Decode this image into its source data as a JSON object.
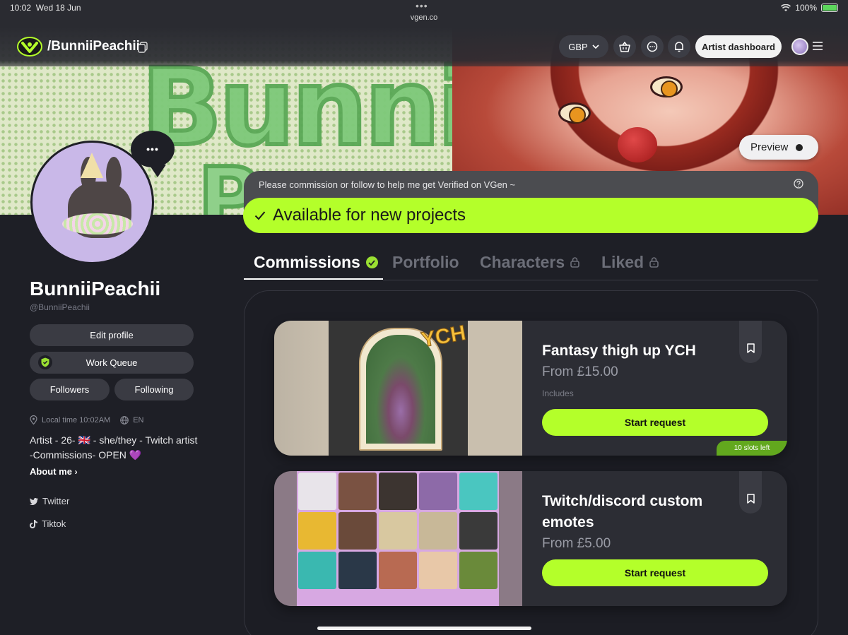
{
  "status_bar": {
    "time": "10:02",
    "date": "Wed 18 Jun",
    "url": "vgen.co",
    "battery": "100%"
  },
  "nav": {
    "username": "/BunniiPeachii",
    "currency": "GBP",
    "artist_dashboard": "Artist dashboard"
  },
  "banner": {
    "preview_label": "Preview"
  },
  "profile": {
    "display_name": "BunniiPeachii",
    "handle": "@BunniiPeachii",
    "edit_profile": "Edit profile",
    "work_queue": "Work Queue",
    "followers": "Followers",
    "following": "Following",
    "local_time": "Local time 10:02AM",
    "language": "EN",
    "bio": "Artist - 26- 🇬🇧 - she/they - Twitch artist -Commissions- OPEN 💜",
    "about_me": "About me",
    "socials": [
      "Twitter",
      "Tiktok"
    ]
  },
  "verify": {
    "prompt": "Please commission or follow to help me get Verified on VGen ~",
    "availability": "Available for new projects"
  },
  "tabs": [
    {
      "label": "Commissions",
      "active": true
    },
    {
      "label": "Portfolio",
      "active": false
    },
    {
      "label": "Characters",
      "active": false
    },
    {
      "label": "Liked",
      "active": false
    }
  ],
  "commissions": [
    {
      "title": "Fantasy thigh up YCH",
      "price": "From £15.00",
      "includes": "Includes",
      "button": "Start request",
      "slots": "10 slots left",
      "image_text": "YCH"
    },
    {
      "title": "Twitch/discord custom emotes",
      "price": "From £5.00",
      "button": "Start request"
    }
  ],
  "colors": {
    "accent": "#b4ff2a",
    "background": "#1e1f26",
    "card": "#2c2d34"
  }
}
